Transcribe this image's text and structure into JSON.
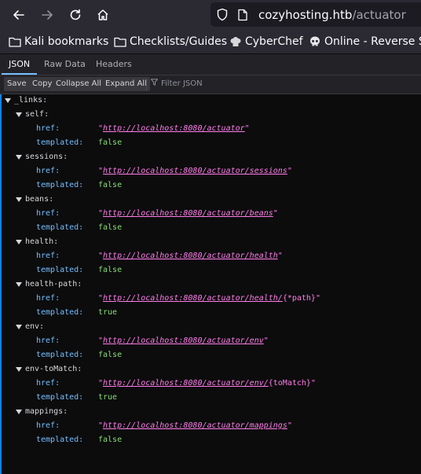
{
  "url": {
    "host": "cozyhosting.htb",
    "path": "/actuator"
  },
  "bookmarks": [
    {
      "label": "Kali bookmarks",
      "icon": "folder-icon"
    },
    {
      "label": "Checklists/Guides",
      "icon": "folder-icon"
    },
    {
      "label": "CyberChef",
      "icon": "chef-hat-icon"
    },
    {
      "label": "Online - Reverse Sh",
      "icon": "skull-icon"
    }
  ],
  "tabs": [
    "JSON",
    "Raw Data",
    "Headers"
  ],
  "toolbar": {
    "save": "Save",
    "copy": "Copy",
    "collapse": "Collapse All",
    "expand": "Expand All",
    "filter": "Filter JSON"
  },
  "json": {
    "root_key": "_links:",
    "href_key": "href:",
    "templated_key": "templated:",
    "links": [
      {
        "name": "self:",
        "href_url": "http://localhost:8080/actuator",
        "href_suffix": "",
        "templated": "false"
      },
      {
        "name": "sessions:",
        "href_url": "http://localhost:8080/actuator/sessions",
        "href_suffix": "",
        "templated": "false"
      },
      {
        "name": "beans:",
        "href_url": "http://localhost:8080/actuator/beans",
        "href_suffix": "",
        "templated": "false"
      },
      {
        "name": "health:",
        "href_url": "http://localhost:8080/actuator/health",
        "href_suffix": "",
        "templated": "false"
      },
      {
        "name": "health-path:",
        "href_url": "http://localhost:8080/actuator/health/",
        "href_suffix": "{*path}",
        "templated": "true"
      },
      {
        "name": "env:",
        "href_url": "http://localhost:8080/actuator/env",
        "href_suffix": "",
        "templated": "false"
      },
      {
        "name": "env-toMatch:",
        "href_url": "http://localhost:8080/actuator/env/",
        "href_suffix": "{toMatch}",
        "templated": "true"
      },
      {
        "name": "mappings:",
        "href_url": "http://localhost:8080/actuator/mappings",
        "href_suffix": "",
        "templated": "false"
      }
    ]
  }
}
